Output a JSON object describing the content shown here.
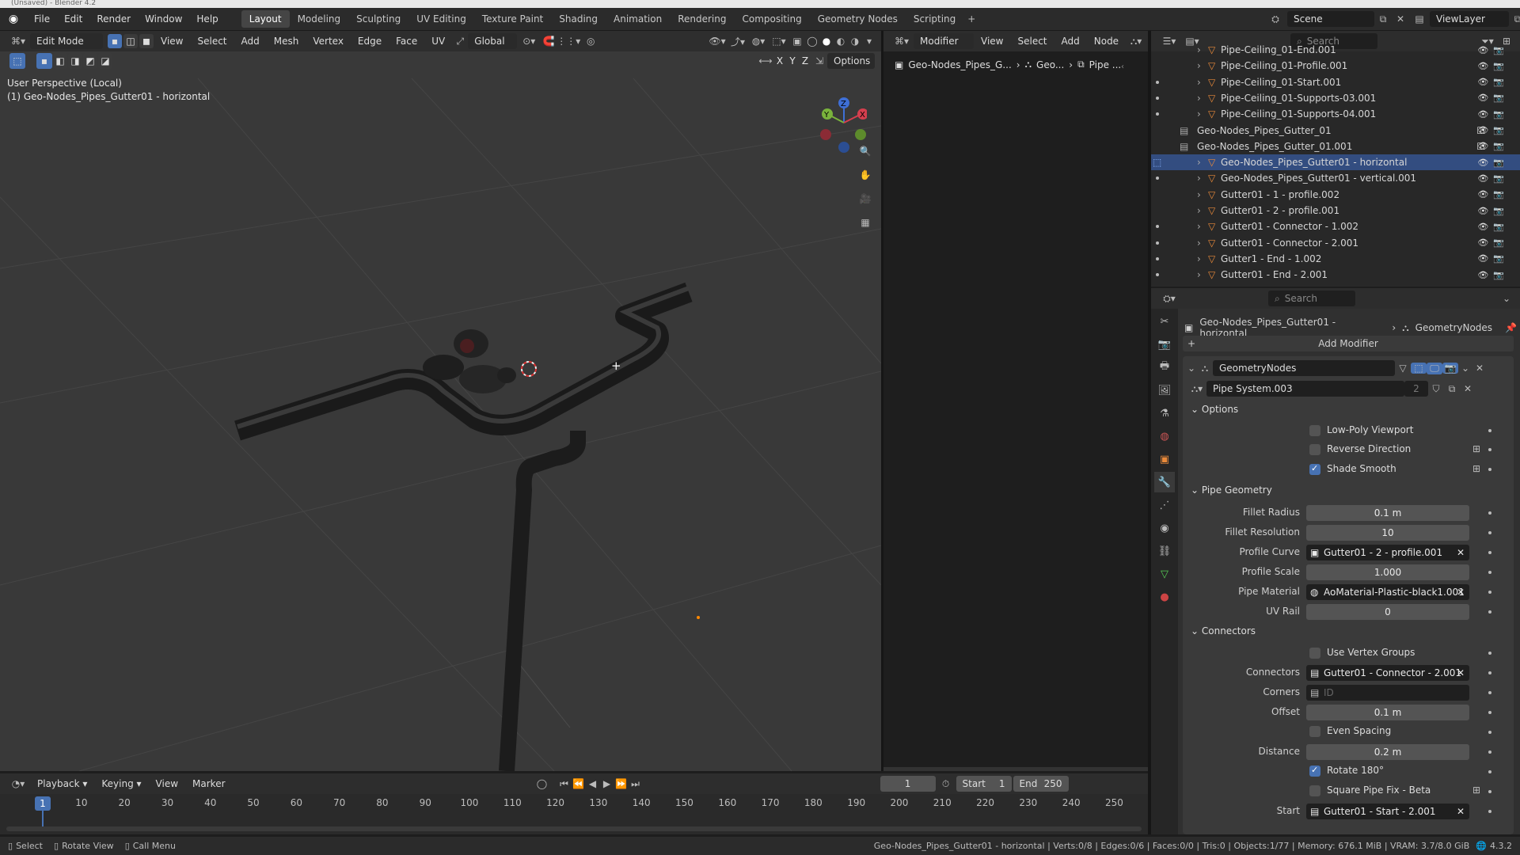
{
  "window": {
    "title": "(Unsaved) - Blender 4.2"
  },
  "topmenu": [
    "File",
    "Edit",
    "Render",
    "Window",
    "Help"
  ],
  "workspaces": [
    "Layout",
    "Modeling",
    "Sculpting",
    "UV Editing",
    "Texture Paint",
    "Shading",
    "Animation",
    "Rendering",
    "Compositing",
    "Geometry Nodes",
    "Scripting"
  ],
  "active_workspace": "Layout",
  "scene": {
    "label": "Scene",
    "viewlayer": "ViewLayer"
  },
  "viewport": {
    "mode": "Edit Mode",
    "menus": [
      "View",
      "Select",
      "Add",
      "Mesh",
      "Vertex",
      "Edge",
      "Face",
      "UV"
    ],
    "orientation": "Global",
    "options": "Options",
    "axes": [
      "X",
      "Y",
      "Z"
    ],
    "perspective": "User Perspective (Local)",
    "object": "(1) Geo-Nodes_Pipes_Gutter01 - horizontal"
  },
  "node_editor": {
    "editor": "Modifier",
    "menus": [
      "View",
      "Select",
      "Add",
      "Node"
    ],
    "breadcrumb": [
      "Geo-Nodes_Pipes_G...",
      "Geo...",
      "Pipe ..."
    ]
  },
  "outliner": {
    "search": "Search",
    "rows": [
      {
        "name": "Pipe-Ceiling_01-End.001",
        "indent": 2,
        "dot": false
      },
      {
        "name": "Pipe-Ceiling_01-Profile.001",
        "indent": 2,
        "dot": false
      },
      {
        "name": "Pipe-Ceiling_01-Start.001",
        "indent": 2,
        "dot": true
      },
      {
        "name": "Pipe-Ceiling_01-Supports-03.001",
        "indent": 2,
        "dot": true
      },
      {
        "name": "Pipe-Ceiling_01-Supports-04.001",
        "indent": 2,
        "dot": true
      },
      {
        "name": "Geo-Nodes_Pipes_Gutter_01",
        "indent": 1,
        "dot": false
      },
      {
        "name": "Geo-Nodes_Pipes_Gutter_01.001",
        "indent": 1,
        "dot": false
      },
      {
        "name": "Geo-Nodes_Pipes_Gutter01 - horizontal",
        "indent": 2,
        "dot": false,
        "hl": true
      },
      {
        "name": "Geo-Nodes_Pipes_Gutter01 - vertical.001",
        "indent": 2,
        "dot": true
      },
      {
        "name": "Gutter01 - 1 - profile.002",
        "indent": 2,
        "dot": false
      },
      {
        "name": "Gutter01 - 2 - profile.001",
        "indent": 2,
        "dot": false
      },
      {
        "name": "Gutter01 - Connector - 1.002",
        "indent": 2,
        "dot": true
      },
      {
        "name": "Gutter01 - Connector - 2.001",
        "indent": 2,
        "dot": true
      },
      {
        "name": "Gutter1 - End - 1.002",
        "indent": 2,
        "dot": true
      },
      {
        "name": "Gutter01 - End - 2.001",
        "indent": 2,
        "dot": true
      }
    ]
  },
  "properties": {
    "search": "Search",
    "breadcrumb_object": "Geo-Nodes_Pipes_Gutter01 - horizontal",
    "breadcrumb_mod": "GeometryNodes",
    "add_modifier": "Add Modifier",
    "modifier_name": "GeometryNodes",
    "node_group": "Pipe System.003",
    "users": "2",
    "sections": {
      "options": "Options",
      "pipe_geometry": "Pipe Geometry",
      "connectors": "Connectors"
    },
    "low_poly": "Low-Poly Viewport",
    "reverse": "Reverse Direction",
    "shade_smooth": "Shade Smooth",
    "fillet_radius_label": "Fillet Radius",
    "fillet_radius": "0.1 m",
    "fillet_res_label": "Fillet Resolution",
    "fillet_res": "10",
    "profile_curve_label": "Profile Curve",
    "profile_curve": "Gutter01 - 2 - profile.001",
    "profile_scale_label": "Profile Scale",
    "profile_scale": "1.000",
    "pipe_material_label": "Pipe Material",
    "pipe_material": "AoMaterial-Plastic-black1.001",
    "uv_rail_label": "UV Rail",
    "uv_rail": "0",
    "use_vgroups": "Use Vertex Groups",
    "connectors_label": "Connectors",
    "connectors": "Gutter01 - Connector - 2.001",
    "corners_label": "Corners",
    "corners": "ID",
    "offset_label": "Offset",
    "offset": "0.1 m",
    "even_spacing": "Even Spacing",
    "distance_label": "Distance",
    "distance": "0.2 m",
    "rotate": "Rotate 180°",
    "square_fix": "Square Pipe Fix - Beta",
    "start_label": "Start",
    "start": "Gutter01 - Start - 2.001"
  },
  "timeline": {
    "menus": [
      "Playback",
      "Keying",
      "View",
      "Marker"
    ],
    "current": "1",
    "start_label": "Start",
    "start": "1",
    "end_label": "End",
    "end": "250",
    "ticks": [
      "1",
      "10",
      "20",
      "30",
      "40",
      "50",
      "60",
      "70",
      "80",
      "90",
      "100",
      "110",
      "120",
      "130",
      "140",
      "150",
      "160",
      "170",
      "180",
      "190",
      "200",
      "210",
      "220",
      "230",
      "240",
      "250"
    ]
  },
  "status": {
    "select": "Select",
    "rotate": "Rotate View",
    "menu": "Call Menu",
    "info": "Geo-Nodes_Pipes_Gutter01 - horizontal | Verts:0/8 | Edges:0/6 | Faces:0/0 | Tris:0 | Objects:1/77 | Memory: 676.1 MiB | VRAM: 3.7/8.0 GiB",
    "version": "4.3.2"
  }
}
